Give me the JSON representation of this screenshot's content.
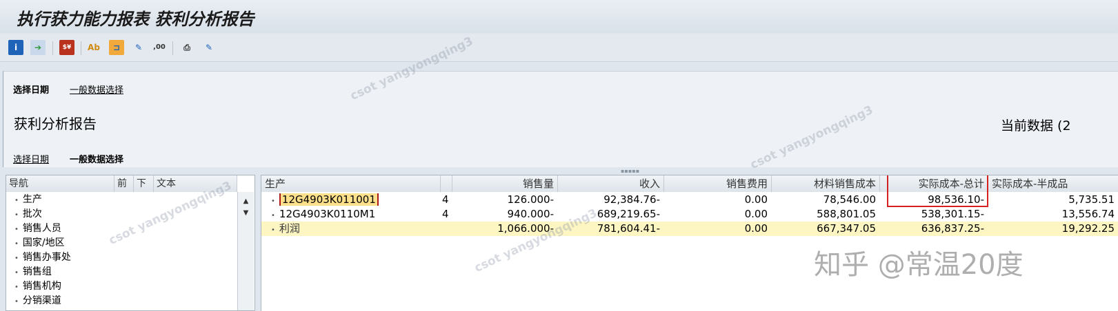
{
  "title": "执行获力能力报表 获利分析报告",
  "toolbar": [
    "info-icon",
    "export-icon",
    "currency-icon",
    "abc-icon",
    "layout-icon",
    "edit-icon",
    "decimal-icon",
    "print-preview-icon",
    "change-icon"
  ],
  "header": {
    "link_date": "选择日期",
    "link_general": "一般数据选择",
    "report_title": "获利分析报告",
    "current_data": "当前数据 (2"
  },
  "nav": {
    "headers": [
      "导航",
      "前",
      "下",
      "文本"
    ],
    "items": [
      "生产",
      "批次",
      "销售人员",
      "国家/地区",
      "销售办事处",
      "销售组",
      "销售机构",
      "分销渠道"
    ]
  },
  "grid": {
    "headers": [
      "生产",
      "",
      "销售量",
      "收入",
      "销售费用",
      "材料销售成本",
      "实际成本-总计",
      "实际成本-半成品"
    ],
    "rows": [
      {
        "name": "12G4903K011001",
        "n": "4",
        "qty": "126.000-",
        "rev": "92,384.76-",
        "exp": "0.00",
        "mat": "78,546.00",
        "total": "98,536.10-",
        "semi": "5,735.51"
      },
      {
        "name": "12G4903K0110M1",
        "n": "4",
        "qty": "940.000-",
        "rev": "689,219.65-",
        "exp": "0.00",
        "mat": "588,801.05",
        "total": "538,301.15-",
        "semi": "13,556.74"
      },
      {
        "name": "利润",
        "n": "",
        "qty": "1,066.000-",
        "rev": "781,604.41-",
        "exp": "0.00",
        "mat": "667,347.05",
        "total": "636,837.25-",
        "semi": "19,292.25"
      }
    ]
  },
  "watermark": "csot yangyongqing3",
  "zhihu": "知乎 @常温20度"
}
